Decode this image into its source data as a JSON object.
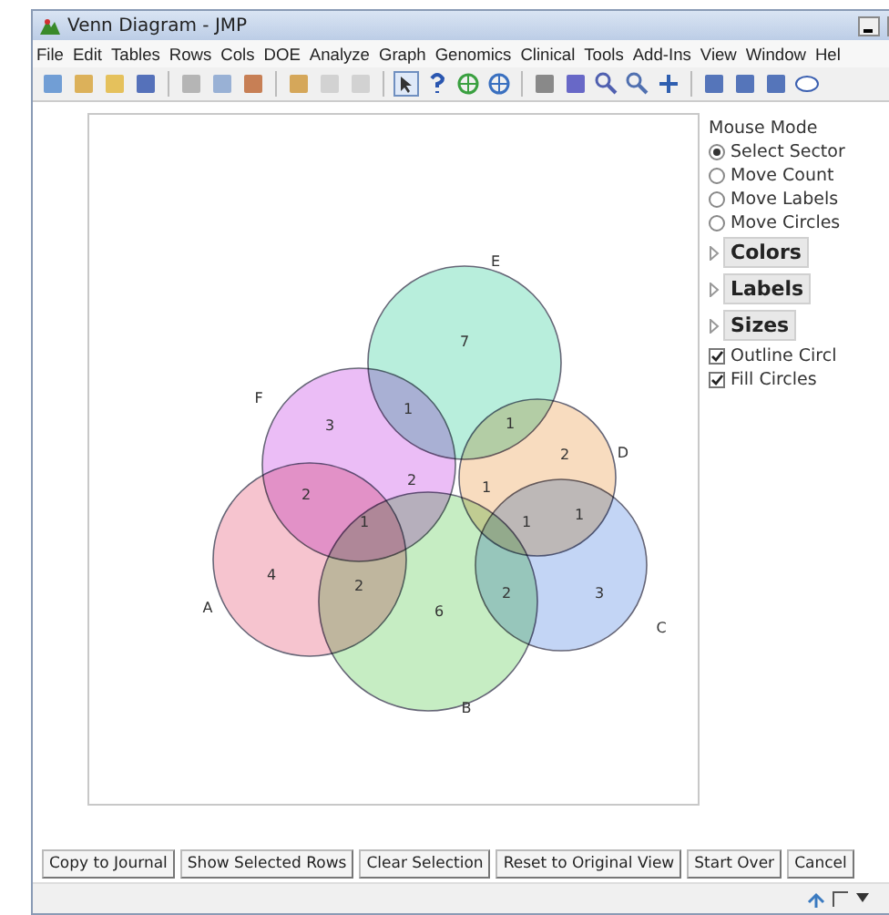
{
  "window": {
    "title": "Venn Diagram - JMP"
  },
  "menu": [
    "File",
    "Edit",
    "Tables",
    "Rows",
    "Cols",
    "DOE",
    "Analyze",
    "Graph",
    "Genomics",
    "Clinical",
    "Tools",
    "Add-Ins",
    "View",
    "Window",
    "Hel"
  ],
  "venn": {
    "sets": [
      {
        "label": "E",
        "color": "#b8eedc"
      },
      {
        "label": "F",
        "color": "#ebbdf6"
      },
      {
        "label": "A",
        "color": "#f6c4cf"
      },
      {
        "label": "B",
        "color": "#c6edc3"
      },
      {
        "label": "D",
        "color": "#f8dcbf"
      },
      {
        "label": "C",
        "color": "#c3d5f5"
      }
    ],
    "regions": [
      "7",
      "1",
      "3",
      "1",
      "2",
      "2",
      "2",
      "1",
      "1",
      "1",
      "1",
      "4",
      "2",
      "6",
      "2",
      "3"
    ]
  },
  "panel": {
    "title": "Mouse Mode",
    "items": [
      {
        "kind": "radio",
        "label": "Select Sector",
        "selected": true
      },
      {
        "kind": "radio",
        "label": "Move Count",
        "selected": false
      },
      {
        "kind": "radio",
        "label": "Move Labels",
        "selected": false
      },
      {
        "kind": "radio",
        "label": "Move Circles",
        "selected": false
      },
      {
        "kind": "outline",
        "label": "Colors",
        "expanded": false
      },
      {
        "kind": "outline",
        "label": "Labels",
        "expanded": false
      },
      {
        "kind": "outline",
        "label": "Sizes",
        "expanded": false
      },
      {
        "kind": "checkbox",
        "label": "Outline Circl",
        "checked": true
      },
      {
        "kind": "checkbox",
        "label": "Fill Circles",
        "checked": true
      }
    ]
  },
  "buttons": [
    "Copy to Journal",
    "Show Selected Rows",
    "Clear Selection",
    "Reset to Original View",
    "Start Over",
    "Cancel"
  ]
}
